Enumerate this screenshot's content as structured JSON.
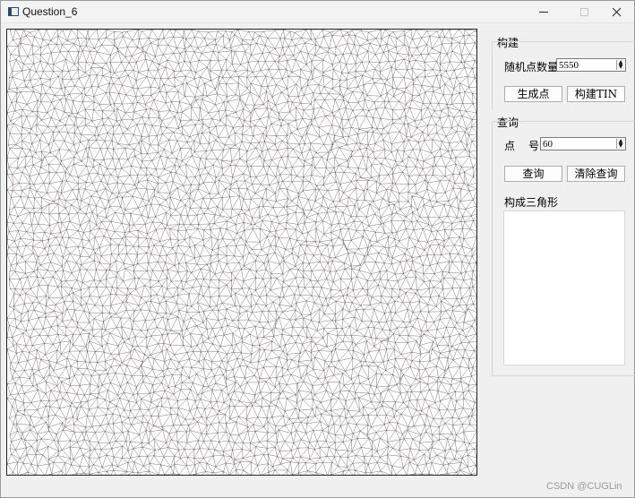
{
  "window": {
    "title": "Question_6",
    "close_symbol": "✕"
  },
  "construction": {
    "group_title": "构建",
    "point_count_label": "随机点数量",
    "point_count_value": "5550",
    "generate_points_label": "生成点",
    "build_tin_label": "构建TIN"
  },
  "query": {
    "group_title": "查询",
    "point_id_label_a": "点",
    "point_id_label_b": "号",
    "point_id_value": "60",
    "query_label": "查询",
    "clear_query_label": "清除查询",
    "triangles_label": "构成三角形"
  },
  "watermark": "CSDN @CUGLin",
  "colors": {
    "triangle_edges": "#666666",
    "points": "#b33a3a",
    "canvas_background": "#ffffff"
  }
}
